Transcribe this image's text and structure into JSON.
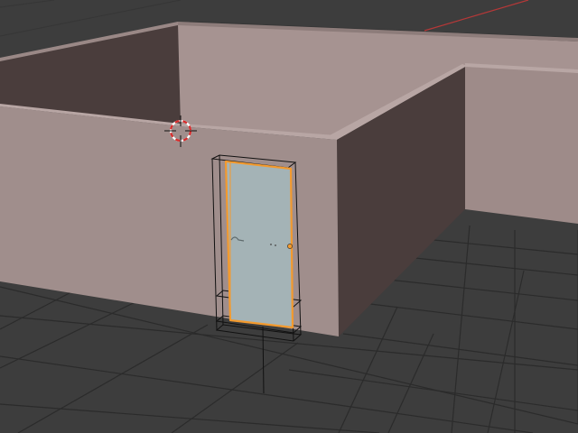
{
  "app": "Blender",
  "view": "3d-viewport",
  "colors": {
    "floor": "#3d3d3d",
    "grid": "#2b2b2b",
    "wall_light": "#a69391",
    "wall_mid": "#9e8b89",
    "wall_dark": "#4a3d3c",
    "door": "#a4b3b6",
    "selection": "#f39a2e",
    "cursor_red": "#d82a2a",
    "axis_x": "#b53838"
  },
  "icons": {
    "cursor": "3d-cursor-icon",
    "origin": "object-origin-icon"
  },
  "objects": [
    {
      "name": "walls",
      "selected": false
    },
    {
      "name": "door",
      "selected": true
    }
  ]
}
